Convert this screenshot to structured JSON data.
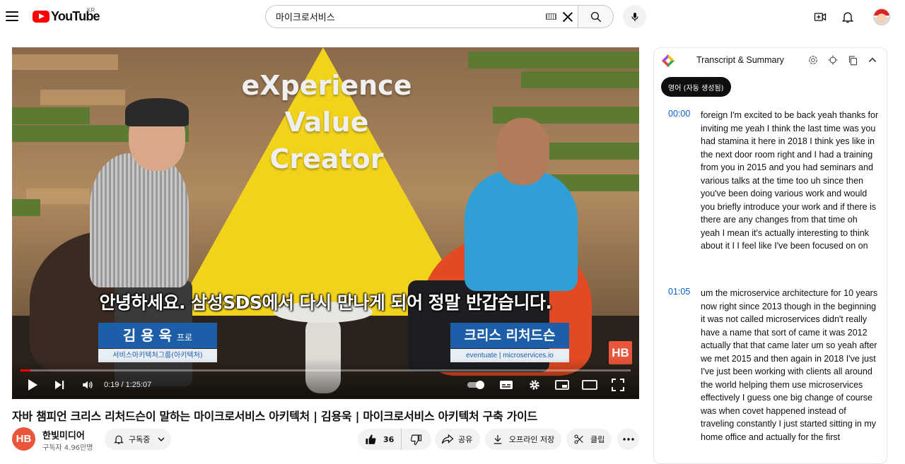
{
  "header": {
    "logo_text": "YouTube",
    "country": "KR",
    "search_value": "마이크로서비스"
  },
  "player": {
    "wall_lines": [
      "eXperience",
      "Value",
      "Creator"
    ],
    "subtitle": "안녕하세요. 삼성SDS에서 다시 만나게 되어 정말 반갑습니다.",
    "left_tag_name": "김 용 욱",
    "left_tag_title": "프로",
    "left_tag_sub": "서비스아키텍처그룹(아키텍처)",
    "right_tag_name": "크리스 리처드슨",
    "right_tag_sub": "eventuate | microservices.io",
    "watermark": "HB",
    "time_display": "0:19 / 1:25:07",
    "progress": 0.004
  },
  "video": {
    "title": "자바 챔피언 크리스 리처드슨이 말하는 마이크로서비스 아키텍처 | 김용욱 | 마이크로서비스 아키텍처 구축 가이드",
    "channel_name": "한빛미디어",
    "channel_avatar": "HB",
    "subscribers": "구독자 4.96만명",
    "subscribe_label": "구독중",
    "likes": "36",
    "share_label": "공유",
    "download_label": "오프라인 저장",
    "clip_label": "클립"
  },
  "panel": {
    "title": "Transcript & Summary",
    "language_chip": "영어 (자동 생성됨)",
    "segments": [
      {
        "time": "00:00",
        "text": "foreign I'm excited to be back yeah thanks for inviting me yeah I think the last time was you had stamina it here in 2018 I think yes like in the next door room right and I had a training from you in 2015 and you had seminars and various talks at the time too uh since then you've been doing various work and would you briefly introduce your work and if there is there are any changes from that time oh yeah I mean it's actually interesting to think about it I I feel like I've been focused on on"
      },
      {
        "time": "01:05",
        "text": "um the microservice architecture for 10 years now right since 2013 though in the beginning it was not called microservices didn't really have a name that sort of came it was 2012 actually that that came later um so yeah after we met 2015 and then again in 2018 I've just I've just been working with clients all around the world helping them use microservices effectively I guess one big change of course was when covet happened instead of traveling constantly I just started sitting in my home office and actually for the first"
      }
    ]
  },
  "colors": {
    "brand_red": "#ff0000",
    "link_blue": "#065fd4",
    "channel_orange": "#e9563b"
  }
}
